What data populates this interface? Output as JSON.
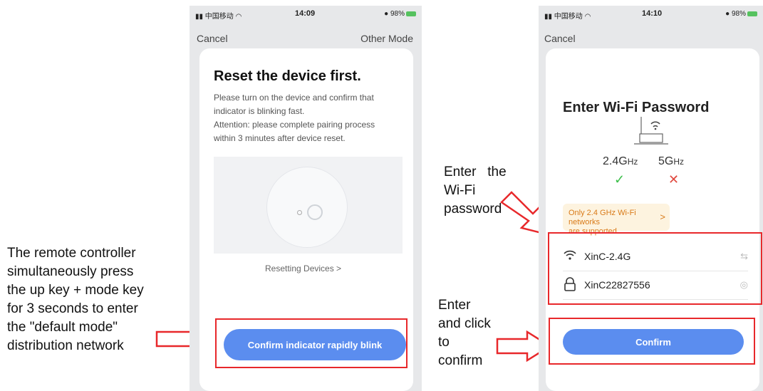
{
  "left_annotation": {
    "lines": [
      "The remote controller",
      "simultaneously press",
      "the up key + mode key",
      "for 3 seconds to enter",
      "the \"default mode\"",
      "distribution network"
    ]
  },
  "right_annotation": {
    "password_lines": [
      "Enter   the",
      "Wi-Fi",
      "password"
    ],
    "confirm_lines": [
      "Enter",
      "and click",
      "to",
      "confirm"
    ]
  },
  "phone1": {
    "status": {
      "carrier": "中国移动",
      "time": "14:09",
      "battery": "98%"
    },
    "cancel": "Cancel",
    "other_mode": "Other Mode",
    "title": "Reset the device first.",
    "description_lines": [
      "Please turn on the device and confirm that",
      "indicator is blinking fast.",
      "Attention: please complete pairing process",
      "within 3 minutes after device reset."
    ],
    "resetting_link": "Resetting Devices >",
    "confirm_button": "Confirm indicator rapidly blink"
  },
  "phone2": {
    "status": {
      "carrier": "中国移动",
      "time": "14:10",
      "battery": "98%"
    },
    "cancel": "Cancel",
    "title": "Enter Wi-Fi Password",
    "band_24": "2.4G",
    "band_5": "5G",
    "band_unit": "Hz",
    "check": "✓",
    "cross": "✕",
    "notice_line1": "Only 2.4 GHz Wi-Fi networks",
    "notice_line2": "are supported",
    "notice_chevron": ">",
    "ssid": "XinC-2.4G",
    "password": "XinC22827556",
    "confirm_button": "Confirm"
  }
}
